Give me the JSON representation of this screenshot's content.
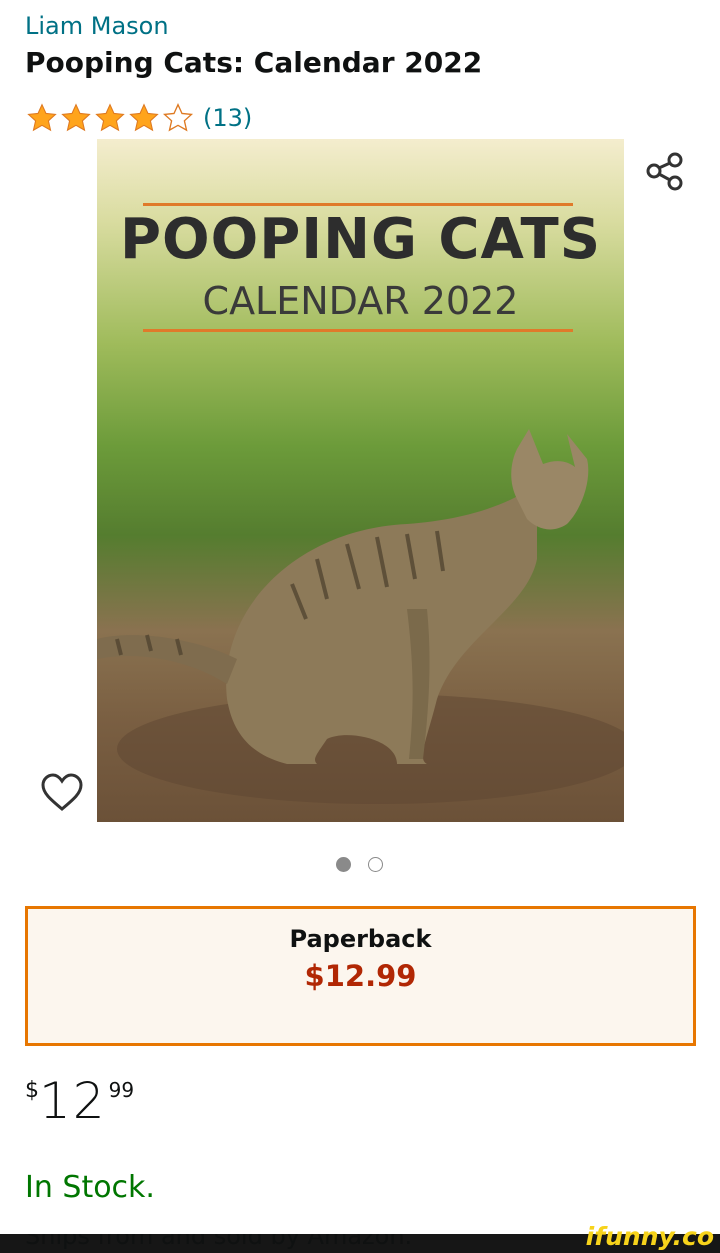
{
  "product": {
    "author": "Liam Mason",
    "title": "Pooping Cats: Calendar 2022",
    "rating": {
      "stars_value": 4.5,
      "count_label": "(13)"
    },
    "cover": {
      "title": "POOPING CATS",
      "subtitle": "CALENDAR 2022"
    },
    "carousel": {
      "image_count": 2,
      "active_index": 0
    },
    "format": {
      "label": "Paperback",
      "price": "$12.99"
    },
    "price": {
      "symbol": "$",
      "whole": "12",
      "fraction": "99"
    },
    "stock_label": "In Stock.",
    "cut_off_text": "Ships from and sold by Amazon."
  },
  "icons": {
    "share": "share-icon",
    "wishlist": "heart-icon",
    "star": "star-icon"
  },
  "colors": {
    "accent": "#e77600",
    "price": "#b12704",
    "link": "#007185",
    "stock": "#007600",
    "star": "#ffa41c"
  },
  "watermark": "ifunny.co"
}
